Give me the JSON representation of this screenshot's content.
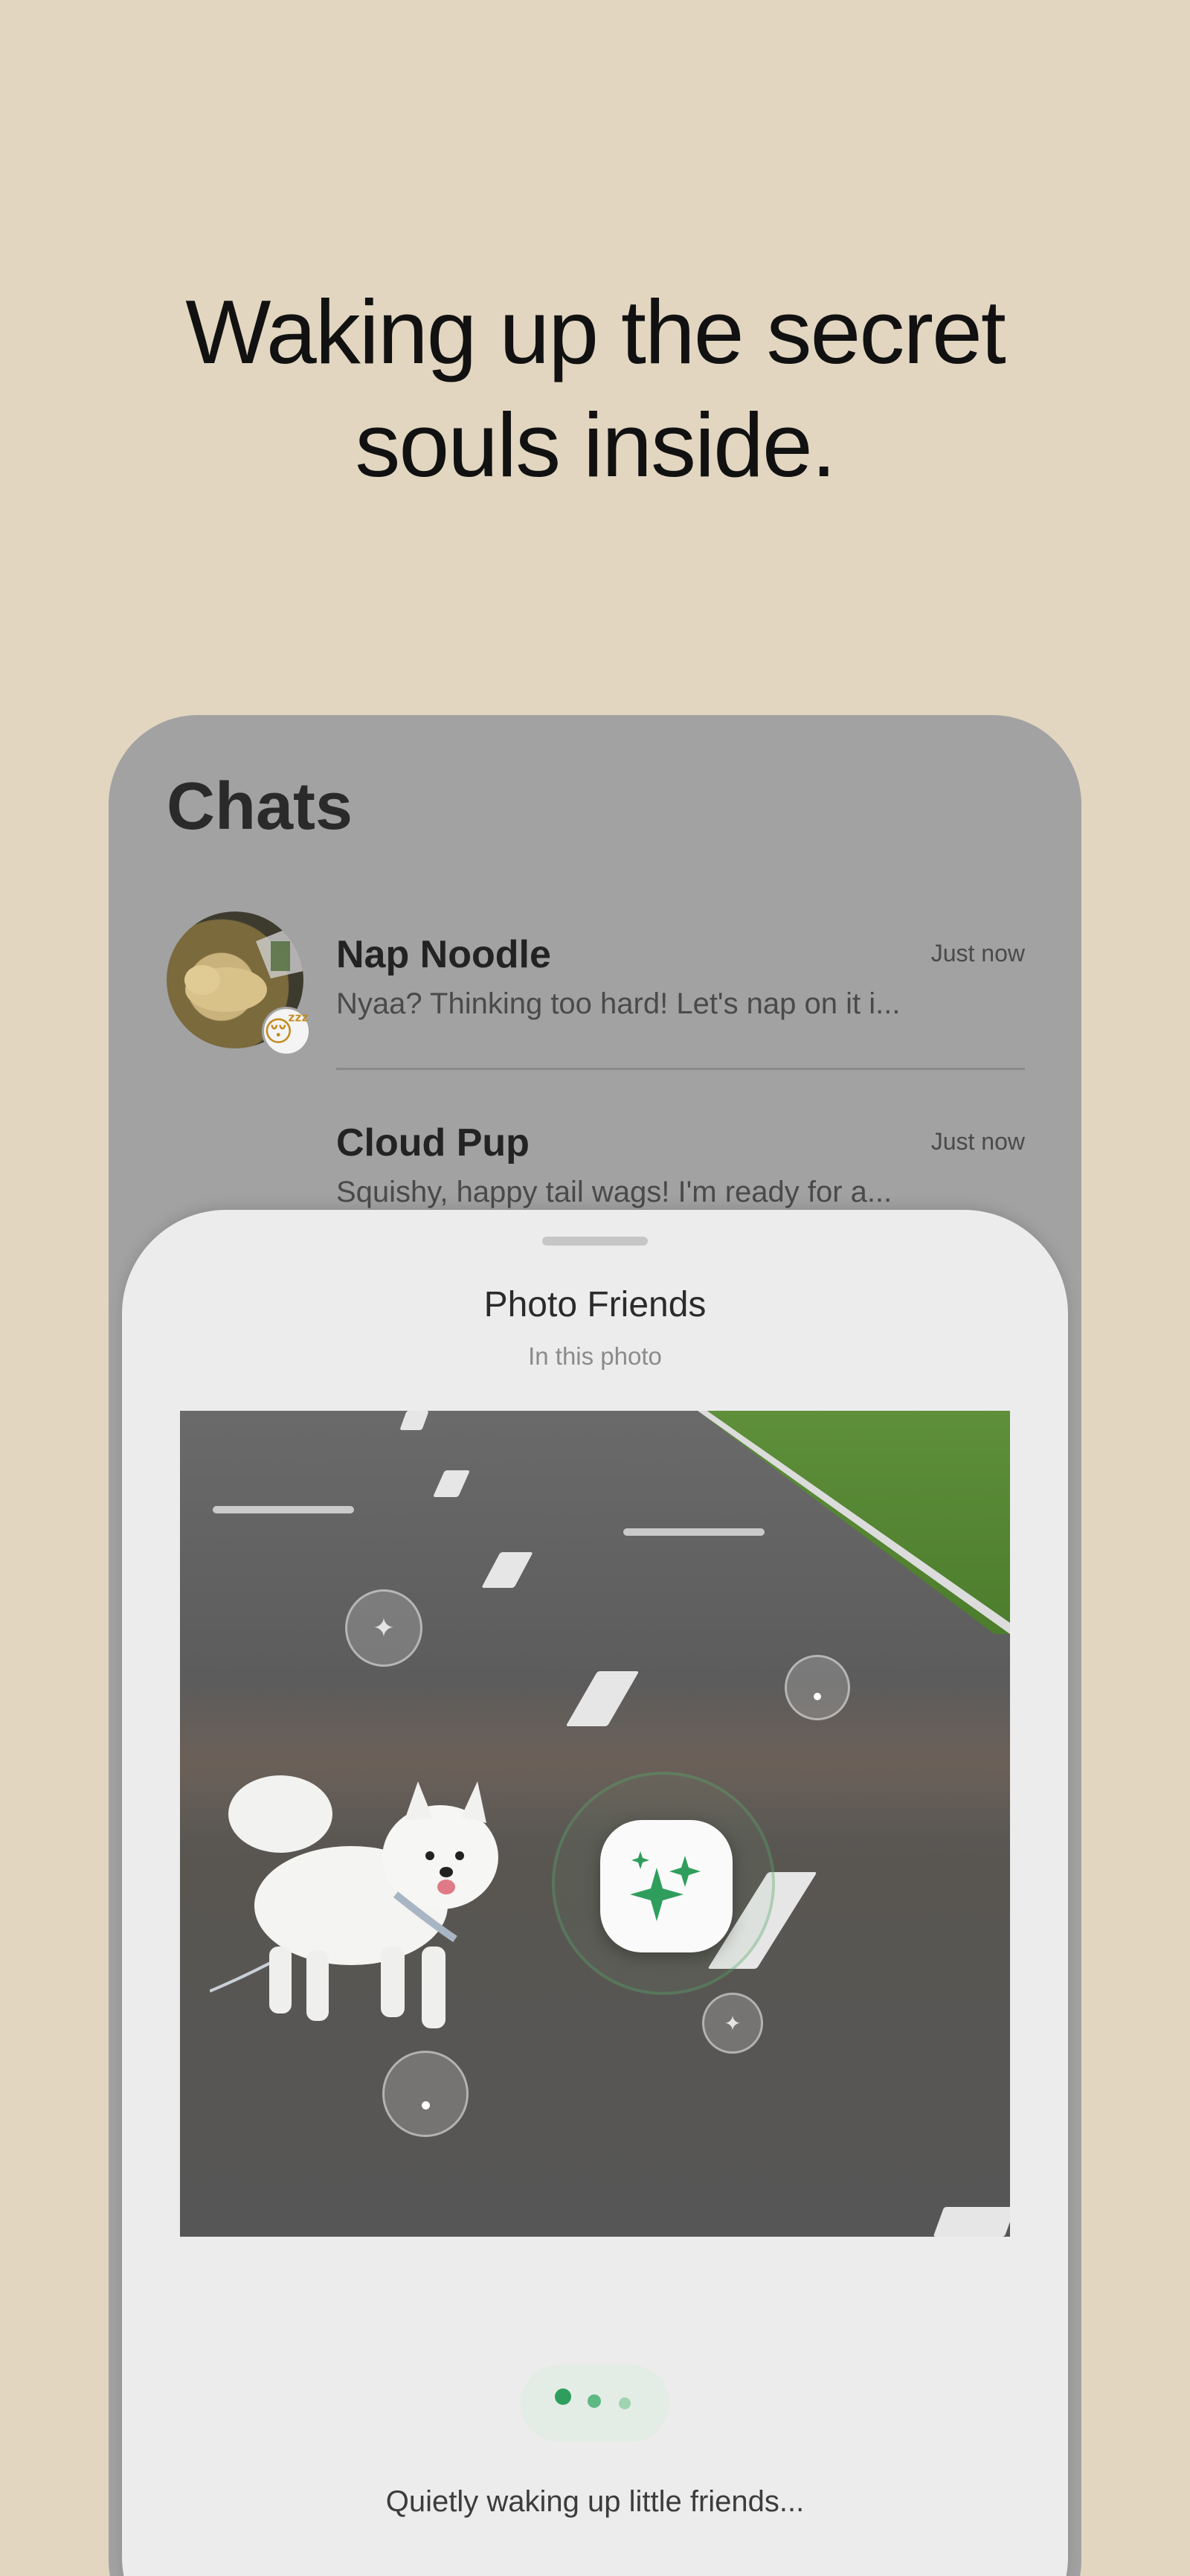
{
  "headline": {
    "line1": "Waking up the secret",
    "line2": "souls inside."
  },
  "chats": {
    "title": "Chats",
    "items": [
      {
        "name": "Nap Noodle",
        "time": "Just now",
        "message": "Nyaa? Thinking too hard! Let's nap on it i...",
        "badge": "😴"
      },
      {
        "name": "Cloud Pup",
        "time": "Just now",
        "message": "Squishy, happy tail wags! I'm ready for a..."
      }
    ]
  },
  "sheet": {
    "title": "Photo Friends",
    "subtitle": "In this photo",
    "status": "Quietly waking up little friends..."
  },
  "colors": {
    "background": "#e2d6c1",
    "accent_green": "#2f9e5c",
    "sheet": "#ececec"
  },
  "icons": {
    "center": "sparkles-icon",
    "markers": [
      "sparkle-icon",
      "dot-icon",
      "dot-icon",
      "sparkle-icon"
    ]
  }
}
